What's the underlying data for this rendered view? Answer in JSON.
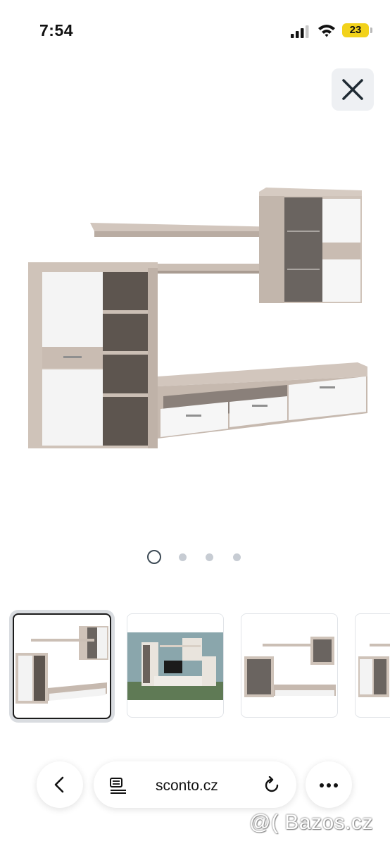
{
  "status_bar": {
    "time": "7:54",
    "battery_level": "23",
    "battery_color": "#f2d21b"
  },
  "viewer": {
    "close_icon": "close-icon",
    "pager": {
      "count": 4,
      "active_index": 0
    },
    "thumbnails": [
      {
        "name": "thumbnail-1",
        "selected": true
      },
      {
        "name": "thumbnail-2",
        "selected": false
      },
      {
        "name": "thumbnail-3",
        "selected": false
      },
      {
        "name": "thumbnail-4",
        "selected": false
      }
    ]
  },
  "browser": {
    "url": "sconto.cz",
    "back_icon": "chevron-left-icon",
    "reader_icon": "reader-mode-icon",
    "reload_icon": "reload-icon",
    "more_icon": "more-icon"
  },
  "watermark": "@( Bazos.cz"
}
